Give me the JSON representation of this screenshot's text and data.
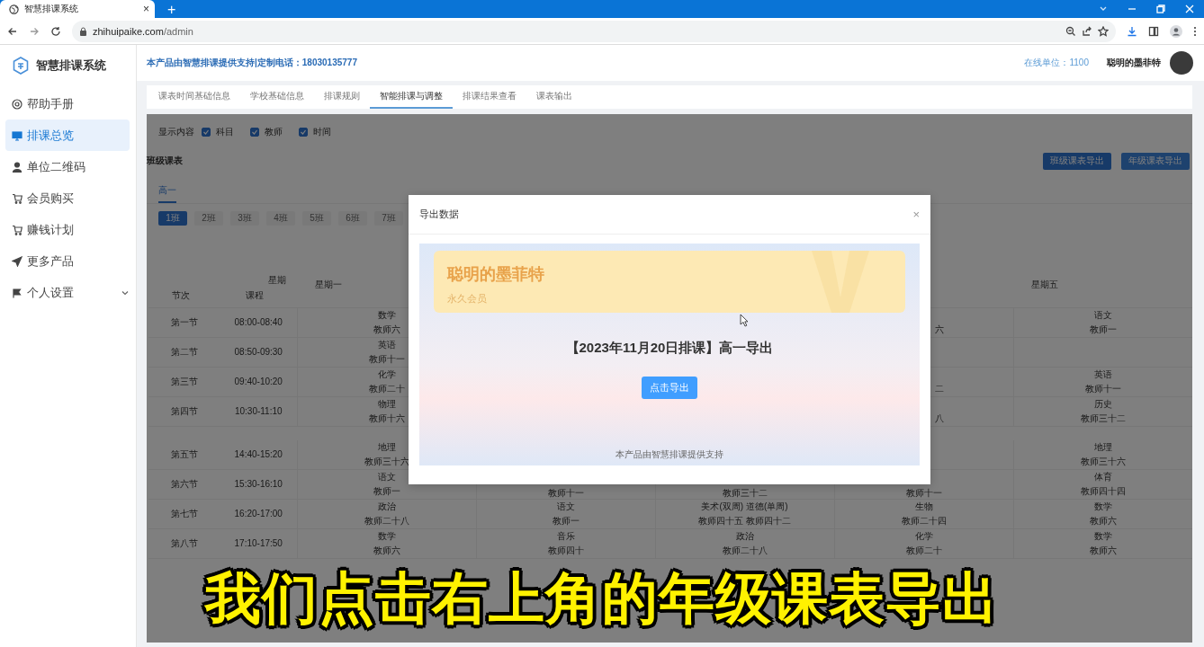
{
  "browser": {
    "tab_title": "智慧排课系统",
    "tab_close": "×",
    "new_tab": "+",
    "url_host": "zhihuipaike.com",
    "url_path": "/admin"
  },
  "sidebar": {
    "title": "智慧排课系统",
    "items": [
      {
        "label": "帮助手册",
        "selected": false
      },
      {
        "label": "排课总览",
        "selected": true
      },
      {
        "label": "单位二维码",
        "selected": false
      },
      {
        "label": "会员购买",
        "selected": false
      },
      {
        "label": "赚钱计划",
        "selected": false
      },
      {
        "label": "更多产品",
        "selected": false
      }
    ],
    "group": {
      "label": "个人设置",
      "expanded": false
    }
  },
  "header": {
    "notice": "本产品由智慧排课提供支持|定制电话：18030135777",
    "online": "在线单位：1100",
    "user": "聪明的墨菲特"
  },
  "tabs": [
    {
      "label": "课表时间基础信息",
      "selected": false
    },
    {
      "label": "学校基础信息",
      "selected": false
    },
    {
      "label": "排课规则",
      "selected": false
    },
    {
      "label": "智能排课与调整",
      "selected": true
    },
    {
      "label": "排课结果查看",
      "selected": false
    },
    {
      "label": "课表输出",
      "selected": false
    }
  ],
  "panel": {
    "display_label": "显示内容",
    "display_options": [
      {
        "label": "科目",
        "checked": true
      },
      {
        "label": "教师",
        "checked": true
      },
      {
        "label": "时间",
        "checked": true
      }
    ],
    "title": "班级课表",
    "buttons": [
      "班级课表导出",
      "年级课表导出"
    ],
    "grades": [
      {
        "label": "高一",
        "selected": true
      }
    ],
    "classes": [
      {
        "label": "1班",
        "selected": true
      },
      {
        "label": "2班",
        "selected": false
      },
      {
        "label": "3班",
        "selected": false
      },
      {
        "label": "4班",
        "selected": false
      },
      {
        "label": "5班",
        "selected": false
      },
      {
        "label": "6班",
        "selected": false
      },
      {
        "label": "7班",
        "selected": false
      }
    ],
    "table": {
      "corner_top": "星期",
      "corner_period": "节次",
      "corner_time": "课程",
      "day_first": "星期一",
      "day_last": "星期五",
      "rows": [
        {
          "period": "第一节",
          "time": "08:00-08:40",
          "break_before": false,
          "cells": [
            {
              "kind": "full",
              "lines": [
                "数学",
                "教师六"
              ]
            },
            null,
            null,
            {
              "kind": "cut_left",
              "lines": [
                "六"
              ]
            },
            {
              "kind": "full",
              "lines": [
                "语文",
                "教师一"
              ]
            }
          ]
        },
        {
          "period": "第二节",
          "time": "08:50-09:30",
          "break_before": false,
          "cells": [
            {
              "kind": "full",
              "lines": [
                "英语",
                "教师十一"
              ]
            },
            null,
            null,
            null,
            null
          ]
        },
        {
          "period": "第三节",
          "time": "09:40-10:20",
          "break_before": false,
          "cells": [
            {
              "kind": "full",
              "lines": [
                "化学",
                "教师二十"
              ]
            },
            null,
            null,
            {
              "kind": "cut_left",
              "lines": [
                "二"
              ]
            },
            {
              "kind": "full",
              "lines": [
                "英语",
                "教师十一"
              ]
            }
          ]
        },
        {
          "period": "第四节",
          "time": "10:30-11:10",
          "break_before": false,
          "cells": [
            {
              "kind": "full",
              "lines": [
                "物理",
                "教师十六"
              ]
            },
            null,
            null,
            {
              "kind": "cut_left",
              "lines": [
                "八"
              ]
            },
            {
              "kind": "full",
              "lines": [
                "历史",
                "教师三十二"
              ]
            }
          ]
        },
        {
          "period": "第五节",
          "time": "14:40-15:20",
          "break_before": true,
          "cells": [
            {
              "kind": "full",
              "lines": [
                "地理",
                "教师三十六"
              ]
            },
            null,
            null,
            null,
            {
              "kind": "full",
              "lines": [
                "地理",
                "教师三十六"
              ]
            }
          ]
        },
        {
          "period": "第六节",
          "time": "15:30-16:10",
          "break_before": false,
          "cells": [
            {
              "kind": "full",
              "lines": [
                "语文",
                "教师一"
              ]
            },
            {
              "kind": "cut_top",
              "lines": [
                "教师十一"
              ]
            },
            {
              "kind": "cut_top",
              "lines": [
                "教师三十二"
              ]
            },
            {
              "kind": "cut_top",
              "lines": [
                "教师十一"
              ]
            },
            {
              "kind": "full",
              "lines": [
                "体育",
                "教师四十四"
              ]
            }
          ]
        },
        {
          "period": "第七节",
          "time": "16:20-17:00",
          "break_before": false,
          "cells": [
            {
              "kind": "full",
              "lines": [
                "政治",
                "教师二十八"
              ]
            },
            {
              "kind": "full",
              "lines": [
                "语文",
                "教师一"
              ]
            },
            {
              "kind": "full",
              "lines": [
                "美术(双周) 道德(单周)",
                "教师四十五 教师四十二"
              ]
            },
            {
              "kind": "full",
              "lines": [
                "生物",
                "教师二十四"
              ]
            },
            {
              "kind": "full",
              "lines": [
                "数学",
                "教师六"
              ]
            }
          ]
        },
        {
          "period": "第八节",
          "time": "17:10-17:50",
          "break_before": false,
          "cells": [
            {
              "kind": "full",
              "lines": [
                "数学",
                "教师六"
              ]
            },
            {
              "kind": "full",
              "lines": [
                "音乐",
                "教师四十"
              ]
            },
            {
              "kind": "full",
              "lines": [
                "政治",
                "教师二十八"
              ]
            },
            {
              "kind": "full",
              "lines": [
                "化学",
                "教师二十"
              ]
            },
            {
              "kind": "full",
              "lines": [
                "数学",
                "教师六"
              ]
            }
          ]
        }
      ]
    }
  },
  "dialog": {
    "title": "导出数据",
    "close": "×",
    "member_name": "聪明的墨菲特",
    "member_level": "永久会员",
    "heading": "【2023年11月20日排课】高一导出",
    "button": "点击导出",
    "footer": "本产品由智慧排课提供支持"
  },
  "caption": "我们点击右上角的年级课表导出"
}
